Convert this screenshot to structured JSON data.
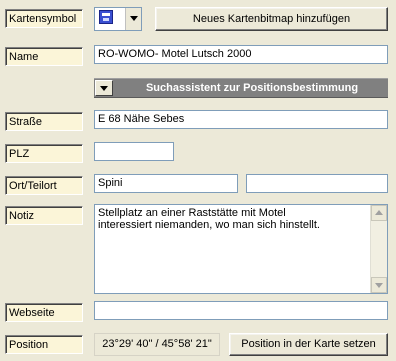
{
  "labels": {
    "symbol": "Kartensymbol",
    "name": "Name",
    "street": "Straße",
    "zip": "PLZ",
    "city": "Ort/Teilort",
    "notes": "Notiz",
    "website": "Webseite",
    "position": "Position"
  },
  "symbol_picker": {
    "icon": "map-marker-icon",
    "add_bitmap_label": "Neues Kartenbitmap hinzufügen"
  },
  "fields": {
    "name": "RO-WOMO- Motel Lutsch 2000",
    "street": "E 68 Nähe Sebes",
    "zip": "",
    "city": "Spini",
    "district": "",
    "notes": "Stellplatz an einer Raststätte mit Motel\ninteressiert niemanden, wo man sich hinstellt.",
    "website": ""
  },
  "assistant": {
    "label": "Suchassistent zur Positionsbestimmung"
  },
  "position": {
    "coords": "23°29' 40\" / 45°58' 21\"",
    "set_on_map_label": "Position in der Karte setzen"
  },
  "colors": {
    "background": "#ece9d8",
    "label_bg": "#fbf5d8",
    "assistant_bar": "#808080",
    "input_border": "#7f9db9"
  }
}
